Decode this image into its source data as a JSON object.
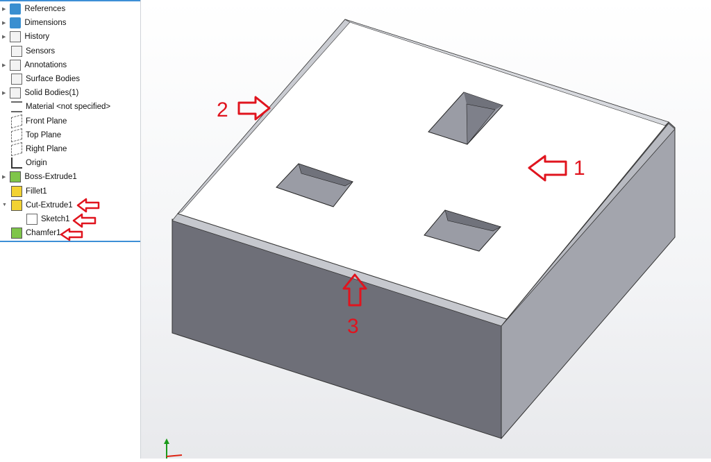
{
  "feature_tree": {
    "items": [
      {
        "label": "References",
        "icon": "folder-icon",
        "expandable": true
      },
      {
        "label": "Dimensions",
        "icon": "folder-icon",
        "expandable": true
      },
      {
        "label": "History",
        "icon": "history-folder-icon",
        "expandable": true
      },
      {
        "label": "Sensors",
        "icon": "sensors-folder-icon",
        "expandable": false
      },
      {
        "label": "Annotations",
        "icon": "annotations-folder-icon",
        "expandable": true
      },
      {
        "label": "Surface Bodies",
        "icon": "surface-bodies-folder-icon",
        "expandable": false
      },
      {
        "label": "Solid Bodies(1)",
        "icon": "solid-bodies-folder-icon",
        "expandable": true
      },
      {
        "label": "Material <not specified>",
        "icon": "material-icon",
        "expandable": false
      },
      {
        "label": "Front Plane",
        "icon": "plane-icon",
        "expandable": false
      },
      {
        "label": "Top Plane",
        "icon": "plane-icon",
        "expandable": false
      },
      {
        "label": "Right Plane",
        "icon": "plane-icon",
        "expandable": false
      },
      {
        "label": "Origin",
        "icon": "origin-icon",
        "expandable": false
      },
      {
        "label": "Boss-Extrude1",
        "icon": "boss-extrude-icon",
        "expandable": true
      },
      {
        "label": "Fillet1",
        "icon": "fillet-icon",
        "expandable": false
      },
      {
        "label": "Cut-Extrude1",
        "icon": "cut-extrude-icon",
        "expandable": true,
        "expanded": true
      },
      {
        "label": "Sketch1",
        "icon": "sketch-icon",
        "expandable": false,
        "child": true
      },
      {
        "label": "Chamfer1",
        "icon": "chamfer-icon",
        "expandable": false
      }
    ]
  },
  "annotations": {
    "label1": "1",
    "label2": "2",
    "label3": "3",
    "arrow_color": "#e0141e"
  },
  "colors": {
    "top_face": "#ffffff",
    "front_face": "#6e6f78",
    "right_face": "#a3a5ad",
    "pocket": "#8d8f98"
  }
}
